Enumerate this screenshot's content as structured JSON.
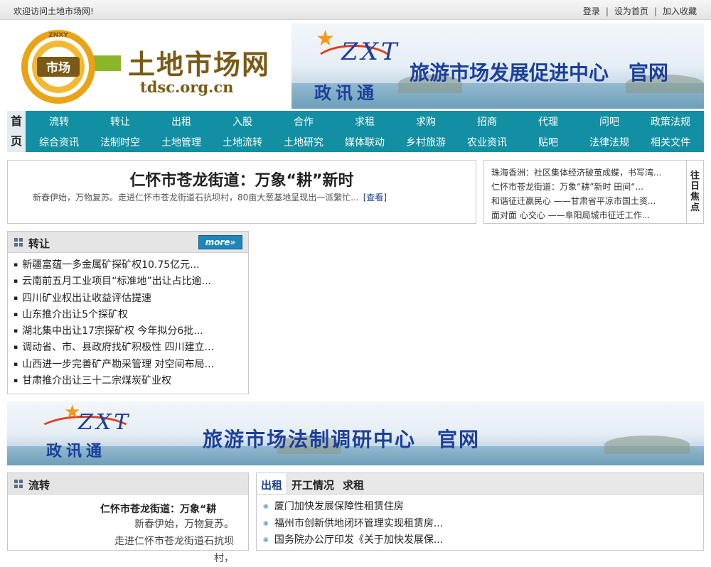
{
  "topbar": {
    "welcome": "欢迎访问土地市场网!",
    "links": [
      "登录",
      "设为首页",
      "加入收藏"
    ]
  },
  "header": {
    "logo_ring_text": "ZNXY",
    "logo_center": "市场",
    "site_name": "土地市场网",
    "site_domain": "tdsc.org.cn"
  },
  "banner_top": {
    "brand": "ZXT",
    "brand_cn": "政讯通",
    "slogan": "旅游市场发展促进中心　官网"
  },
  "nav": {
    "home": "首页",
    "row1": [
      "流转",
      "转让",
      "出租",
      "入股",
      "合作",
      "求租",
      "求购",
      "招商",
      "代理",
      "问吧",
      "政策法规"
    ],
    "row2": [
      "综合资讯",
      "法制时空",
      "土地管理",
      "土地流转",
      "土地研究",
      "媒体联动",
      "乡村旅游",
      "农业资讯",
      "贴吧",
      "法律法规",
      "相关文件"
    ]
  },
  "headline": {
    "title": "仁怀市苍龙街道：万象“耕”新时",
    "summary": "新春伊始，万物复苏。走进仁怀市苍龙街道石抗坝村，80亩大葱基地呈现出一派繁忙...",
    "view_label": "[查看]"
  },
  "focus": {
    "side_label": "往日焦点",
    "items": [
      "珠海香洲：社区集体经济破茧成蝶，书写湾...",
      "仁怀市苍龙街道：万象“耕”新时 田间“...",
      "和谐征迁赢民心 ——甘肃省平凉市国土资...",
      "面对面 心交心 ——阜阳局城市征迁工作..."
    ]
  },
  "transfer": {
    "title": "转让",
    "more": "more»",
    "items": [
      "新疆富蕴一多金属矿探矿权10.75亿元...",
      "云南前五月工业项目“标准地”出让占比逾...",
      "四川矿业权出让收益评估提速",
      "山东推介出让5个探矿权",
      "湖北集中出让17宗探矿权 今年拟分6批...",
      "调动省、市、县政府找矿积极性 四川建立...",
      "山西进一步完善矿产勘采管理 对空间布局...",
      "甘肃推介出让三十二宗煤炭矿业权"
    ]
  },
  "banner_mid": {
    "brand": "ZXT",
    "brand_cn": "政讯通",
    "slogan": "旅游市场法制调研中心　官网"
  },
  "circulation": {
    "title": "流转",
    "feature_title": "仁怀市苍龙街道：万象“耕",
    "feature_lines": [
      "新春伊始，万物复苏。",
      "走进仁怀市苍龙街道石抗坝村，"
    ]
  },
  "rent_tabs": {
    "tabs": [
      "出租",
      "开工情况",
      "求租"
    ],
    "items": [
      "厦门加快发展保障性租赁住房",
      "福州市创新供地闭环管理实现租赁房...",
      "国务院办公厅印发《关于加快发展保..."
    ]
  },
  "colors": {
    "nav_bg": "#138fa3",
    "brand_brown": "#7a5a16",
    "banner_blue": "#1d3f9c",
    "more_btn": "#1e86b8"
  }
}
